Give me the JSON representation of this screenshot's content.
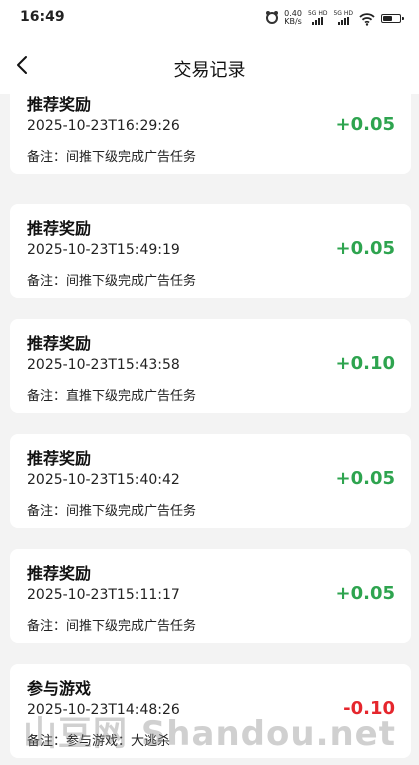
{
  "status_bar": {
    "time": "16:49",
    "net_speed_value": "0.40",
    "net_speed_unit": "KB/s",
    "signal1_label": "5G HD",
    "signal2_label": "5G HD",
    "icons": [
      "alarm-icon",
      "signal-icon",
      "signal-icon",
      "wifi-icon",
      "battery-icon"
    ]
  },
  "header": {
    "title": "交易记录",
    "back_icon": "chevron-left-icon"
  },
  "colors": {
    "positive": "#2ea44f",
    "negative": "#e5262d",
    "background": "#f3f3f3"
  },
  "records": [
    {
      "title": "推荐奖励",
      "time": "2025-10-23T16:29:26",
      "note_label": "备注：",
      "note": "间推下级完成广告任务",
      "amount": "+0.05",
      "sign": "positive"
    },
    {
      "title": "推荐奖励",
      "time": "2025-10-23T15:49:19",
      "note_label": "备注：",
      "note": "间推下级完成广告任务",
      "amount": "+0.05",
      "sign": "positive"
    },
    {
      "title": "推荐奖励",
      "time": "2025-10-23T15:43:58",
      "note_label": "备注：",
      "note": "直推下级完成广告任务",
      "amount": "+0.10",
      "sign": "positive"
    },
    {
      "title": "推荐奖励",
      "time": "2025-10-23T15:40:42",
      "note_label": "备注：",
      "note": "间推下级完成广告任务",
      "amount": "+0.05",
      "sign": "positive"
    },
    {
      "title": "推荐奖励",
      "time": "2025-10-23T15:11:17",
      "note_label": "备注：",
      "note": "间推下级完成广告任务",
      "amount": "+0.05",
      "sign": "positive"
    },
    {
      "title": "参与游戏",
      "time": "2025-10-23T14:48:26",
      "note_label": "备注：",
      "note": "参与游戏：大逃杀",
      "amount": "-0.10",
      "sign": "negative"
    }
  ],
  "watermark": "山豆网 Shandou.net"
}
